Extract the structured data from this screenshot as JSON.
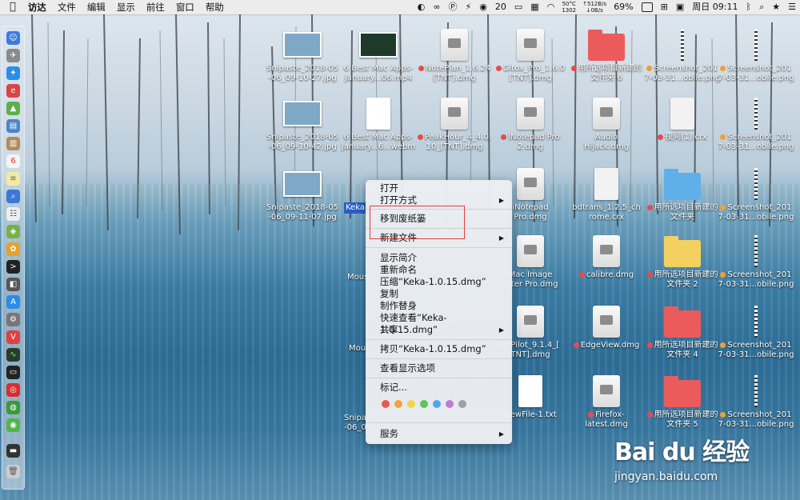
{
  "menubar": {
    "app_name": "访达",
    "menus": [
      "文件",
      "编辑",
      "显示",
      "前往",
      "窗口",
      "帮助"
    ],
    "status": {
      "notif_count": "20",
      "cpu_temp": "50°C",
      "cpu_rpm": "1302",
      "net_up": "↑512B/s",
      "net_down": "↓0B/s",
      "battery": "69%",
      "clock": "周日 09:11"
    }
  },
  "desktop_items": [
    {
      "label": "Snipaste_2018-05\n-06_09-10-27.jpg",
      "kind": "thumb"
    },
    {
      "label": "6 Best Mac Apps-\nJanuary...06.mp4",
      "kind": "video"
    },
    {
      "label": "NotePlan_1.6.24\n[TNT].dmg",
      "kind": "disk",
      "tag": "#e84b4b"
    },
    {
      "label": "Gitox_Pro_1.6.0\n[TNT].dmg",
      "kind": "disk",
      "tag": "#e84b4b"
    },
    {
      "label": "用所选项目新建的\n文件夹 6",
      "kind": "folder-red",
      "tag": "#e84b4b"
    },
    {
      "label": "Screenshot_201\n7-03-31...obile.png",
      "kind": "strip",
      "tag": "#f0a030"
    },
    {
      "label": "Screenshot_201\n7-03-31...obile.png",
      "kind": "strip",
      "tag": "#f0a030"
    },
    {
      "label": "Snipaste_2018-05\n-06_09-10-42.jpg",
      "kind": "thumb"
    },
    {
      "label": "6 Best Mac Apps-\nJanuary...6...webm",
      "kind": "doc"
    },
    {
      "label": "PeakHour_4_4.0.\n10_[TNT].dmg",
      "kind": "disk",
      "tag": "#e84b4b"
    },
    {
      "label": "iNotepad Pro\n2.dmg",
      "kind": "disk",
      "tag": "#e84b4b"
    },
    {
      "label": "Audio\nHijack.dmg",
      "kind": "disk"
    },
    {
      "label": "夜间(1).crx",
      "kind": "zip",
      "tag": "#e84b4b"
    },
    {
      "label": "Screenshot_201\n7-03-31...obile.png",
      "kind": "strip",
      "tag": "#f0a030"
    },
    {
      "label": "Snipaste_2018-05\n-06_09-11-07.jpg",
      "kind": "thumb"
    },
    {
      "label": "iNotepad\nPro.dmg",
      "kind": "disk"
    },
    {
      "label": "bdtrans_1.2.5_ch\nrome.crx",
      "kind": "zip"
    },
    {
      "label": "用所选项目新建的\n文件夹",
      "kind": "folder-blue",
      "tag": "#e84b4b"
    },
    {
      "label": "Screenshot_201\n7-03-31...obile.png",
      "kind": "strip",
      "tag": "#f0a030"
    },
    {
      "label": "Mac Image\nerter Pro.dmg",
      "kind": "disk"
    },
    {
      "label": "calibre.dmg",
      "kind": "disk",
      "tag": "#e84b4b"
    },
    {
      "label": "用所选项目新建的\n文件夹 2",
      "kind": "folder-yellow",
      "tag": "#e84b4b"
    },
    {
      "label": "Screenshot_201\n7-03-31...obile.png",
      "kind": "strip",
      "tag": "#f0a030"
    },
    {
      "label": "acPilot_9.1.4_[\nTNT].dmg",
      "kind": "disk"
    },
    {
      "label": "EdgeView.dmg",
      "kind": "disk",
      "tag": "#e84b4b"
    },
    {
      "label": "用所选项目新建的\n文件夹 4",
      "kind": "folder-red",
      "tag": "#e84b4b"
    },
    {
      "label": "Screenshot_201\n7-03-31...obile.png",
      "kind": "strip",
      "tag": "#f0a030"
    },
    {
      "label": "NewFile-1.txt",
      "kind": "txt"
    },
    {
      "label": "Firefox-\nlatest.dmg",
      "kind": "disk",
      "tag": "#e84b4b"
    },
    {
      "label": "用所选项目新建的\n文件夹 5",
      "kind": "folder-red",
      "tag": "#e84b4b"
    },
    {
      "label": "Screenshot_201\n7-03-31...obile.png",
      "kind": "strip",
      "tag": "#f0a030"
    }
  ],
  "partial_labels": {
    "selected_file": "Keka",
    "mous1": "Mous",
    "mous2": "Mou",
    "snipas": "Snipas\n-06_0"
  },
  "context_menu": {
    "items": [
      {
        "label": "打开"
      },
      {
        "label": "打开方式",
        "submenu": true
      },
      {
        "label": "移到废纸篓"
      },
      {
        "label": "新建文件",
        "submenu": true
      },
      {
        "label": "显示简介"
      },
      {
        "label": "重新命名"
      },
      {
        "label": "压缩“Keka-1.0.15.dmg”"
      },
      {
        "label": "复制"
      },
      {
        "label": "制作替身"
      },
      {
        "label": "快速查看“Keka-1.0.15.dmg”"
      },
      {
        "label": "共享",
        "submenu": true
      },
      {
        "label": "拷贝“Keka-1.0.15.dmg”"
      },
      {
        "label": "查看显示选项"
      },
      {
        "label": "标记..."
      },
      {
        "label": "服务",
        "submenu": true
      }
    ],
    "tag_colors": [
      "#e8594f",
      "#f3a23c",
      "#f5d34a",
      "#5fc45a",
      "#4fa6ee",
      "#c07ad8",
      "#a0a0a0"
    ]
  },
  "watermark": {
    "logo": "Bai du 经验",
    "url": "jingyan.baidu.com"
  },
  "icons": {
    "apple": "apple-logo-icon",
    "wifi": "wifi-icon",
    "bluetooth": "bluetooth-icon",
    "search": "search-icon"
  }
}
